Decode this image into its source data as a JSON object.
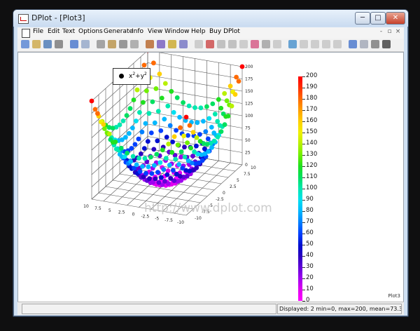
{
  "window": {
    "title": "DPlot - [Plot3]",
    "minimize": "─",
    "maximize": "□",
    "close": "✕"
  },
  "menu": {
    "items": [
      "File",
      "Edit",
      "Text",
      "Options",
      "Generate",
      "Info",
      "View",
      "Window",
      "Help",
      "Buy DPlot"
    ],
    "mdi_minimize": "-",
    "mdi_restore": "▫",
    "mdi_close": "×"
  },
  "toolbar": {
    "icons": [
      "new-icon",
      "open-icon",
      "save-icon",
      "print-icon",
      "undo-icon",
      "redo-icon",
      "copy-icon",
      "paste-icon",
      "clipboard-icon",
      "delete-icon",
      "edit-icon",
      "edit2-icon",
      "pencil-icon",
      "eraser-icon",
      "grid-icon",
      "table-icon",
      "box-icon",
      "cube-icon",
      "frame-icon",
      "colorbar-icon",
      "arrow-icon",
      "zoom-fit-icon",
      "chart-icon",
      "hist-icon",
      "image-icon",
      "image2-icon",
      "curve-icon",
      "zoom-in-icon",
      "zoom-out-icon",
      "pointer-icon",
      "crosshair-icon"
    ]
  },
  "plot": {
    "legend_label": "x",
    "legend_sup1": "2",
    "legend_mid": "+y",
    "legend_sup2": "2",
    "watermark": "http://www.dplot.com",
    "corner_label": "Plot3",
    "colorbar": {
      "ticks": [
        "200",
        "190",
        "180",
        "170",
        "160",
        "150",
        "140",
        "130",
        "120",
        "110",
        "100",
        "90",
        "80",
        "70",
        "60",
        "50",
        "40",
        "30",
        "20",
        "10",
        "0"
      ],
      "colors": [
        "#ff0000",
        "#ff3000",
        "#ff6a00",
        "#ffa000",
        "#ffd000",
        "#f0f000",
        "#b8f000",
        "#70f000",
        "#20e020",
        "#00e060",
        "#00e8b0",
        "#00e0f0",
        "#00b8ff",
        "#0080ff",
        "#0040ff",
        "#0010d0",
        "#2a00c0",
        "#6000d8",
        "#a000f0",
        "#e000f0",
        "#ff00ff"
      ]
    },
    "x_ticks": [
      "10",
      "7.5",
      "5",
      "2.5",
      "0",
      "-2.5",
      "-5",
      "-7.5",
      "-10"
    ],
    "y_ticks": [
      "-10",
      "-7.5",
      "-5",
      "-2.5",
      "0",
      "2.5",
      "5",
      "7.5",
      "10"
    ],
    "z_ticks": [
      "0",
      "25",
      "50",
      "75",
      "100",
      "125",
      "150",
      "175",
      "200"
    ],
    "x_range": [
      -10,
      10
    ],
    "y_range": [
      -10,
      10
    ],
    "z_range": [
      0,
      200
    ]
  },
  "status": {
    "left": "",
    "right": "Displayed: 2 min=0, max=200, mean=73.3333"
  }
}
